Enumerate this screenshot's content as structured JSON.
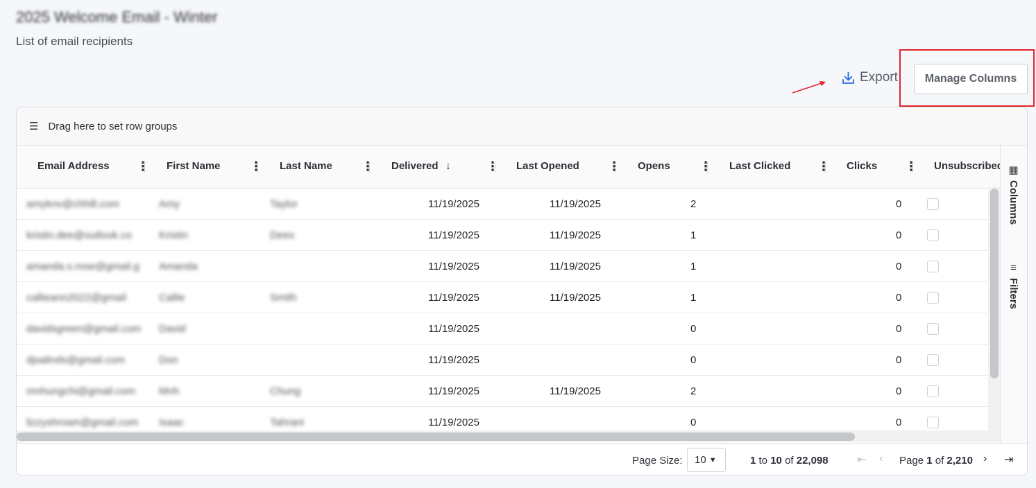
{
  "page": {
    "title": "2025 Welcome Email - Winter",
    "subtitle": "List of email recipients"
  },
  "toolbar": {
    "export_label": "Export",
    "manage_columns_label": "Manage Columns"
  },
  "grid": {
    "group_bar_text": "Drag here to set row groups",
    "columns": [
      {
        "label": "Email Address"
      },
      {
        "label": "First Name"
      },
      {
        "label": "Last Name"
      },
      {
        "label": "Delivered",
        "sort": "descending"
      },
      {
        "label": "Last Opened"
      },
      {
        "label": "Opens"
      },
      {
        "label": "Last Clicked"
      },
      {
        "label": "Clicks"
      },
      {
        "label": "Unsubscribed"
      }
    ],
    "rows": [
      {
        "email": "amyknv@chhill.com",
        "first": "Amy",
        "last": "Taylor",
        "delivered": "11/19/2025",
        "last_opened": "11/19/2025",
        "opens": "2",
        "last_clicked": "",
        "clicks": "0"
      },
      {
        "email": "kristin.dee@outlook.co",
        "first": "Kristin",
        "last": "Dees",
        "delivered": "11/19/2025",
        "last_opened": "11/19/2025",
        "opens": "1",
        "last_clicked": "",
        "clicks": "0"
      },
      {
        "email": "amanda.s.rose@gmail.g",
        "first": "Amanda",
        "last": "",
        "delivered": "11/19/2025",
        "last_opened": "11/19/2025",
        "opens": "1",
        "last_clicked": "",
        "clicks": "0"
      },
      {
        "email": "callieann2022@gmail",
        "first": "Callie",
        "last": "Smith",
        "delivered": "11/19/2025",
        "last_opened": "11/19/2025",
        "opens": "1",
        "last_clicked": "",
        "clicks": "0"
      },
      {
        "email": "davidsgreen@gmail.com",
        "first": "David",
        "last": "",
        "delivered": "11/19/2025",
        "last_opened": "",
        "opens": "0",
        "last_clicked": "",
        "clicks": "0"
      },
      {
        "email": "djsalinds@gmail.com",
        "first": "Don",
        "last": "",
        "delivered": "11/19/2025",
        "last_opened": "",
        "opens": "0",
        "last_clicked": "",
        "clicks": "0"
      },
      {
        "email": "mnhungchi@gmail.com",
        "first": "Mnh",
        "last": "Chung",
        "delivered": "11/19/2025",
        "last_opened": "11/19/2025",
        "opens": "2",
        "last_clicked": "",
        "clicks": "0"
      },
      {
        "email": "lizzyshrown@gmail.com",
        "first": "Isaac",
        "last": "Tahrani",
        "delivered": "11/19/2025",
        "last_opened": "",
        "opens": "0",
        "last_clicked": "",
        "clicks": "0"
      }
    ],
    "side_panel": {
      "columns_label": "Columns",
      "filters_label": "Filters"
    }
  },
  "pager": {
    "page_size_label": "Page Size:",
    "page_size_value": "10",
    "range_from": "1",
    "range_to_word": "to",
    "range_to": "10",
    "of_word": "of",
    "total": "22,098",
    "page_word": "Page",
    "current_page": "1",
    "total_pages": "2,210"
  },
  "colors": {
    "annotation_red": "#e0252a",
    "export_icon_blue": "#2f6fde"
  }
}
